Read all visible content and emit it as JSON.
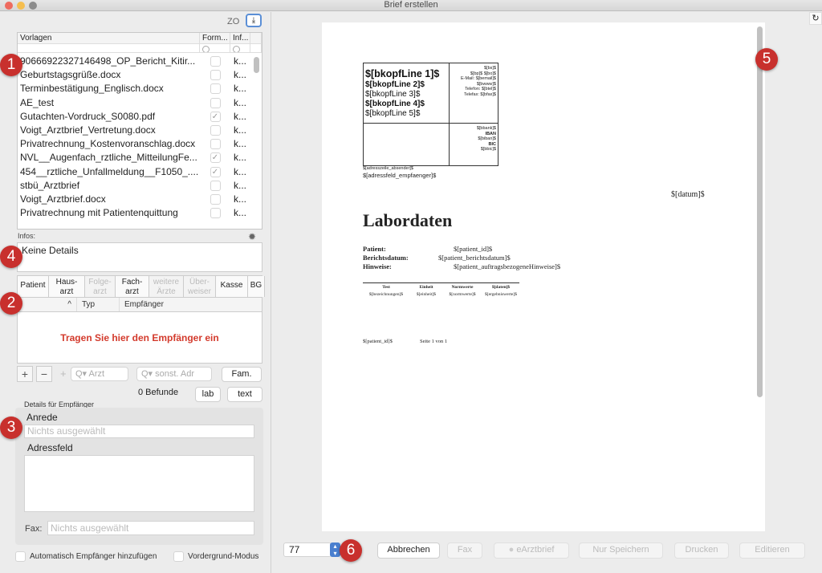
{
  "window": {
    "title": "Brief erstellen"
  },
  "badges": [
    "1",
    "2",
    "3",
    "4",
    "5",
    "6"
  ],
  "toolbar": {
    "zo_label": "ZO",
    "collapse_icon": "collapse-down-icon"
  },
  "templates": {
    "headers": {
      "name": "Vorlagen",
      "form": "Form...",
      "info": "Inf..."
    },
    "rows": [
      {
        "name": "90666922327146498_OP_Bericht_Kitir...",
        "form": false,
        "info": "k..."
      },
      {
        "name": "Geburtstagsgrüße.docx",
        "form": false,
        "info": "k..."
      },
      {
        "name": "Terminbestätigung_Englisch.docx",
        "form": false,
        "info": "k..."
      },
      {
        "name": "AE_test",
        "form": false,
        "info": "k..."
      },
      {
        "name": "Gutachten-Vordruck_S0080.pdf",
        "form": true,
        "info": "k..."
      },
      {
        "name": "Voigt_Arztbrief_Vertretung.docx",
        "form": false,
        "info": "k..."
      },
      {
        "name": "Privatrechnung_Kostenvoranschlag.docx",
        "form": false,
        "info": "k..."
      },
      {
        "name": "NVL__Augenfach_rztliche_MitteilungFe...",
        "form": true,
        "info": "k..."
      },
      {
        "name": "454__rztliche_Unfallmeldung__F1050_....",
        "form": true,
        "info": "k..."
      },
      {
        "name": "stbü_Arztbrief",
        "form": false,
        "info": "k..."
      },
      {
        "name": "Voigt_Arztbrief.docx",
        "form": false,
        "info": "k..."
      },
      {
        "name": "Privatrechnung mit Patientenquittung",
        "form": false,
        "info": "k..."
      }
    ]
  },
  "infos": {
    "label": "Infos:",
    "text": "Keine Details"
  },
  "recipient_tabs": [
    {
      "line1": "Patient",
      "line2": "",
      "enabled": true
    },
    {
      "line1": "Haus-",
      "line2": "arzt",
      "enabled": true
    },
    {
      "line1": "Folge-",
      "line2": "arzt",
      "enabled": false
    },
    {
      "line1": "Fach-",
      "line2": "arzt",
      "enabled": true
    },
    {
      "line1": "weitere",
      "line2": "Ärzte",
      "enabled": false
    },
    {
      "line1": "Über-",
      "line2": "weiser",
      "enabled": false
    },
    {
      "line1": "Kasse",
      "line2": "",
      "enabled": true
    },
    {
      "line1": "BG",
      "line2": "",
      "enabled": true
    }
  ],
  "recipients": {
    "headers": {
      "sort": "^",
      "type": "Typ",
      "recipient": "Empfänger"
    },
    "empty_hint": "Tragen Sie hier den Empfänger ein",
    "add": "+",
    "remove": "−",
    "plus_small": "+",
    "search_doctor_placeholder": "Q▾ Arzt",
    "search_other_placeholder": "Q▾ sonst. Adr",
    "fam_button": "Fam.",
    "findings_count": "0 Befunde",
    "lab_button": "lab",
    "text_button": "text"
  },
  "details": {
    "label": "Details für Empfänger",
    "salutation_label": "Anrede",
    "salutation_value": "Nichts ausgewählt",
    "address_label": "Adressfeld",
    "address_value": "",
    "fax_label": "Fax:",
    "fax_value": "Nichts ausgewählt"
  },
  "options": {
    "auto_add": {
      "label": "Automatisch Empfänger hinzufügen",
      "checked": false
    },
    "foreground": {
      "label": "Vordergrund-Modus",
      "checked": false
    }
  },
  "preview": {
    "kopf_lines": [
      "$[bkopfLine 1]$",
      "$[bkopfLine 2]$",
      "$[bkopfLine 3]$",
      "$[bkopfLine 4]$",
      "$[bkopfLine 5]$"
    ],
    "kopf_right": [
      "$[bs]$",
      "$[bp]$ $[bo]$",
      "E-Mail: $[bemail]$",
      "$[bwww]$",
      "Telefon: $[btel]$",
      "Telefax: $[bfax]$"
    ],
    "bank": [
      "$[bbank]$",
      "IBAN",
      "$[biban]$",
      "BIC",
      "$[bbic]$"
    ],
    "sender_line": "$[adresszeile_absender]$",
    "recipient_field": "$[adressfeld_empfaenger]$",
    "date": "$[datum]$",
    "heading": "Labordaten",
    "fields": [
      {
        "label": "Patient:",
        "value": "$[patient_id]$"
      },
      {
        "label": "Berichtsdatum:",
        "value": "$[patient_berichtsdatum]$"
      },
      {
        "label": "Hinweise:",
        "value": "$[patient_auftragsbezogeneHinweise]$"
      }
    ],
    "lab_headers": [
      "Test",
      "Einheit",
      "Normwerte",
      "$[daten]$"
    ],
    "lab_row": [
      "$[bezeichnungen]$",
      "$[einheit]$",
      "$[normwerte]$",
      "$[ergebniswerte]$"
    ],
    "footer_id": "$[patient_id]$",
    "footer_page": "Seite 1 von 1"
  },
  "bottom": {
    "zoom_value": "77",
    "cancel": "Abbrechen",
    "fax": "Fax",
    "earztbrief": "eArztbrief",
    "save_only": "Nur Speichern",
    "print": "Drucken",
    "edit": "Editieren"
  }
}
